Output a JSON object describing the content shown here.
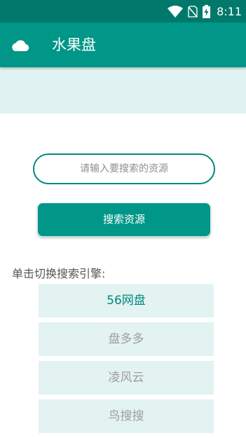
{
  "status_bar": {
    "time": "8:11",
    "icons": [
      "wifi-icon",
      "no-sim-icon",
      "battery-charging-icon"
    ]
  },
  "app_bar": {
    "icon": "cloud-icon",
    "title": "水果盘"
  },
  "search": {
    "placeholder": "请输入要搜索的资源",
    "value": "",
    "button_label": "搜索资源"
  },
  "engines": {
    "label": "单击切换搜索引擎:",
    "items": [
      {
        "label": "56网盘",
        "selected": true
      },
      {
        "label": "盘多多",
        "selected": false
      },
      {
        "label": "凌风云",
        "selected": false
      },
      {
        "label": "鸟搜搜",
        "selected": false
      }
    ]
  },
  "colors": {
    "status_bar": "#00796b",
    "app_bar": "#009688",
    "banner": "#e0f2f1",
    "engine_item": "#e2f3f2",
    "engine_active_text": "#00897b",
    "engine_inactive_text": "#9e9e9e"
  }
}
